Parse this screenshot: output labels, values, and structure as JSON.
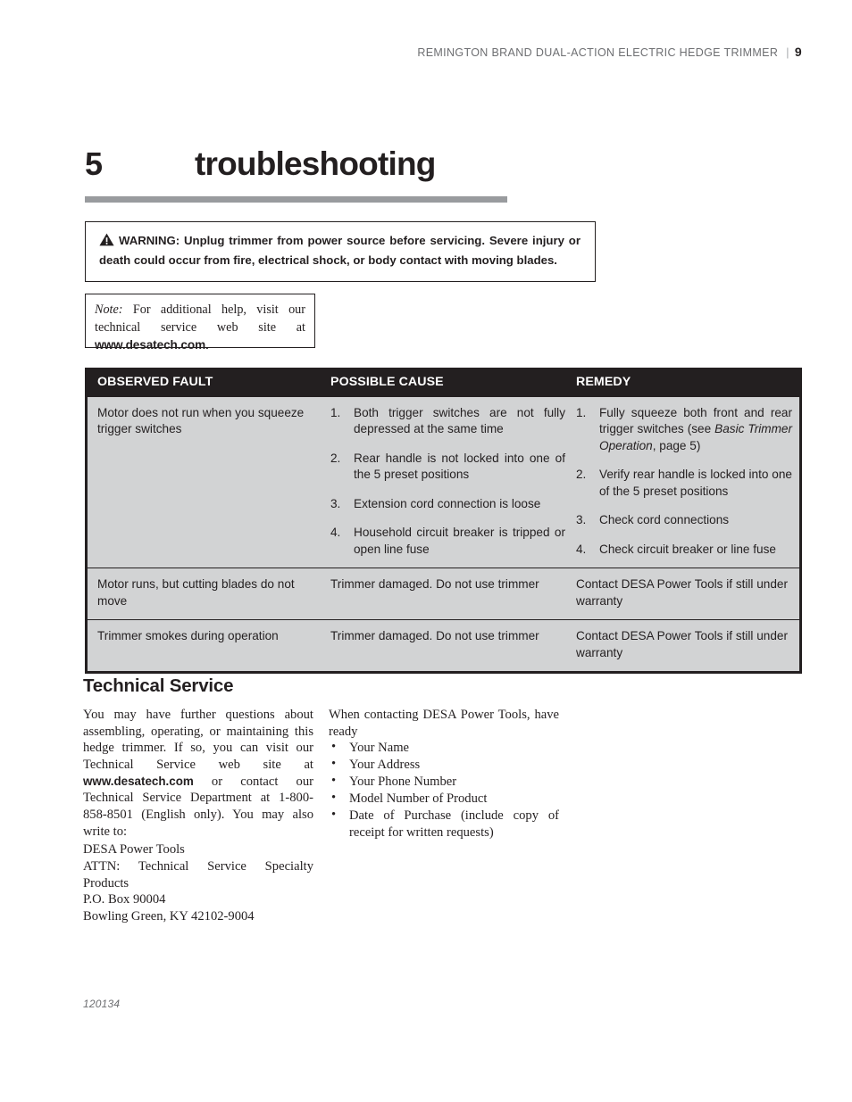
{
  "header": {
    "running_head": "REMINGTON BRAND DUAL-ACTION ELECTRIC HEDGE TRIMMER",
    "separator": "|",
    "page_number": "9"
  },
  "chapter": {
    "number": "5",
    "title": "troubleshooting",
    "rule_color": "#999b9e"
  },
  "warning": {
    "icon": "warning-triangle-icon",
    "text": "WARNING: Unplug trimmer from power source before servicing. Severe injury or death could occur from fire, electrical shock, or body contact with moving blades."
  },
  "note": {
    "label": "Note:",
    "line1": "For additional help, visit our",
    "line2": "technical service web site at",
    "url": "www.desatech.com."
  },
  "table": {
    "header_bg": "#231f20",
    "row_bg": "#d2d3d4",
    "columns": [
      "OBSERVED FAULT",
      "POSSIBLE CAUSE",
      "REMEDY"
    ],
    "rows": [
      {
        "fault": "Motor does not run when you squeeze trigger switches",
        "causes": [
          "Both trigger switches are not fully depressed at the same time",
          "Rear handle is not locked into one of the 5 preset positions",
          "Extension cord connection is loose",
          "Household circuit breaker is tripped or open line fuse"
        ],
        "remedies": [
          {
            "pre": "Fully squeeze both front and rear trigger switches (see ",
            "italic": "Basic Trimmer Operation",
            "post": ", page 5)"
          },
          {
            "pre": "Verify rear handle is locked into one of the 5 preset positions",
            "italic": "",
            "post": ""
          },
          {
            "pre": "Check cord connections",
            "italic": "",
            "post": ""
          },
          {
            "pre": "Check circuit breaker or line fuse",
            "italic": "",
            "post": ""
          }
        ]
      },
      {
        "fault": "Motor runs, but cutting blades do not move",
        "cause": "Trimmer damaged. Do not use trimmer",
        "remedy": "Contact DESA Power Tools if still under warranty"
      },
      {
        "fault": "Trimmer smokes during operation",
        "cause": "Trimmer damaged. Do not use trimmer",
        "remedy": "Contact DESA Power Tools if still under warranty"
      }
    ]
  },
  "technical_service": {
    "heading": "Technical Service",
    "left": {
      "para_part1": "You may have further questions about assembling, operating, or maintaining this hedge trimmer. If so, you can visit our Technical Service web site at ",
      "url": "www.desatech.com",
      "para_part2": " or contact our Technical Service Department at 1-800-858-8501 (English only). You may also write to:",
      "address": [
        "DESA Power Tools",
        "ATTN: Technical Service Specialty Products",
        "P.O. Box 90004",
        "Bowling Green, KY 42102-9004"
      ]
    },
    "right": {
      "intro": "When contacting DESA Power Tools, have ready",
      "bullet_char": "•",
      "items": [
        "Your Name",
        "Your Address",
        "Your Phone Number",
        "Model Number of Product",
        "Date of Purchase (include copy of receipt for written requests)"
      ]
    }
  },
  "footer": {
    "code": "120134"
  }
}
